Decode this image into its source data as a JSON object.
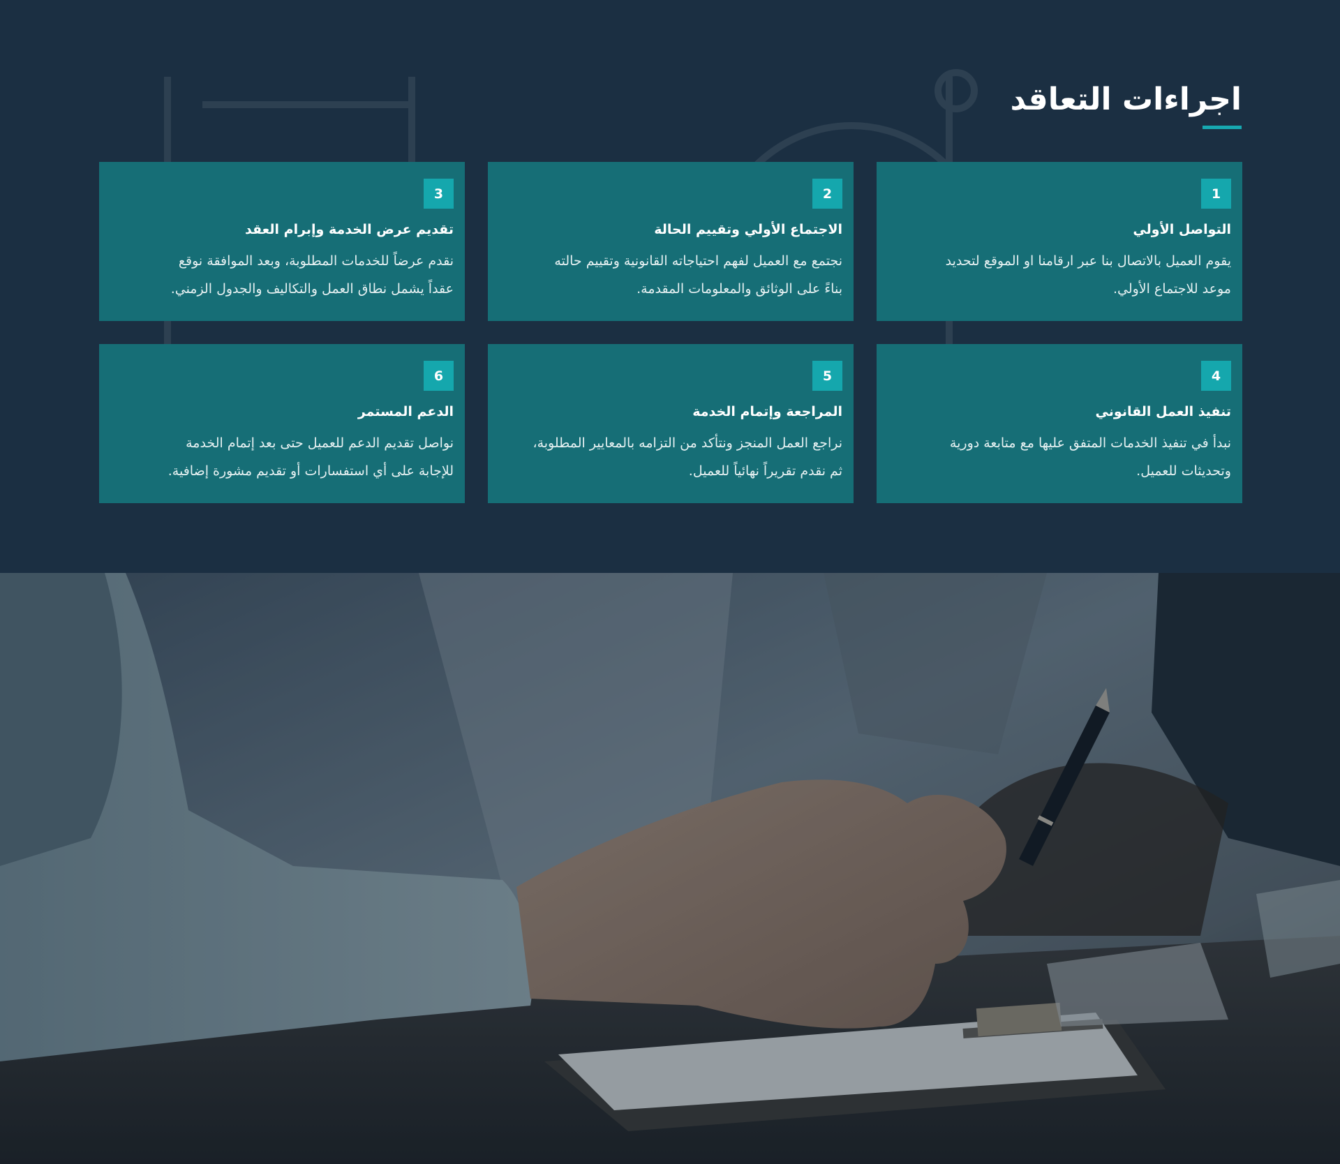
{
  "contract_procedures": {
    "title": "اجراءات التعاقد",
    "steps": [
      {
        "number": "1",
        "title": "التواصل الأولي",
        "desc_line1": "يقوم العميل بالاتصال بنا عبر ارقامنا او الموقع لتحديد",
        "desc_line2": "موعد للاجتماع الأولي."
      },
      {
        "number": "2",
        "title": "الاجتماع الأولي وتقييم الحالة",
        "desc_line1": "نجتمع مع العميل لفهم احتياجاته القانونية وتقييم حالته",
        "desc_line2": "بناءً على الوثائق والمعلومات المقدمة."
      },
      {
        "number": "3",
        "title": "تقديم عرض الخدمة وإبرام العقد",
        "desc_line1": "نقدم عرضاً للخدمات المطلوبة، وبعد الموافقة نوقع",
        "desc_line2": "عقداً يشمل نطاق العمل والتكاليف والجدول الزمني."
      },
      {
        "number": "4",
        "title": "تنفيذ العمل القانوني",
        "desc_line1": "نبدأ في تنفيذ الخدمات المتفق عليها مع متابعة دورية",
        "desc_line2": "وتحديثات للعميل."
      },
      {
        "number": "5",
        "title": "المراجعة وإتمام الخدمة",
        "desc_line1": "نراجع العمل المنجز ونتأكد من التزامه بالمعايير المطلوبة،",
        "desc_line2": "ثم نقدم تقريراً نهائياً للعميل."
      },
      {
        "number": "6",
        "title": "الدعم المستمر",
        "desc_line1": "نواصل تقديم الدعم للعميل حتى بعد إتمام الخدمة",
        "desc_line2": "للإجابة على أي استفسارات أو تقديم مشورة إضافية."
      }
    ]
  },
  "colors": {
    "section_background": "#1b2f42",
    "card_background": "#166e76",
    "accent": "#15a7ad",
    "text": "#ffffff"
  },
  "photo": {
    "subject": "hand-holding-pen-signing-contract-image"
  }
}
